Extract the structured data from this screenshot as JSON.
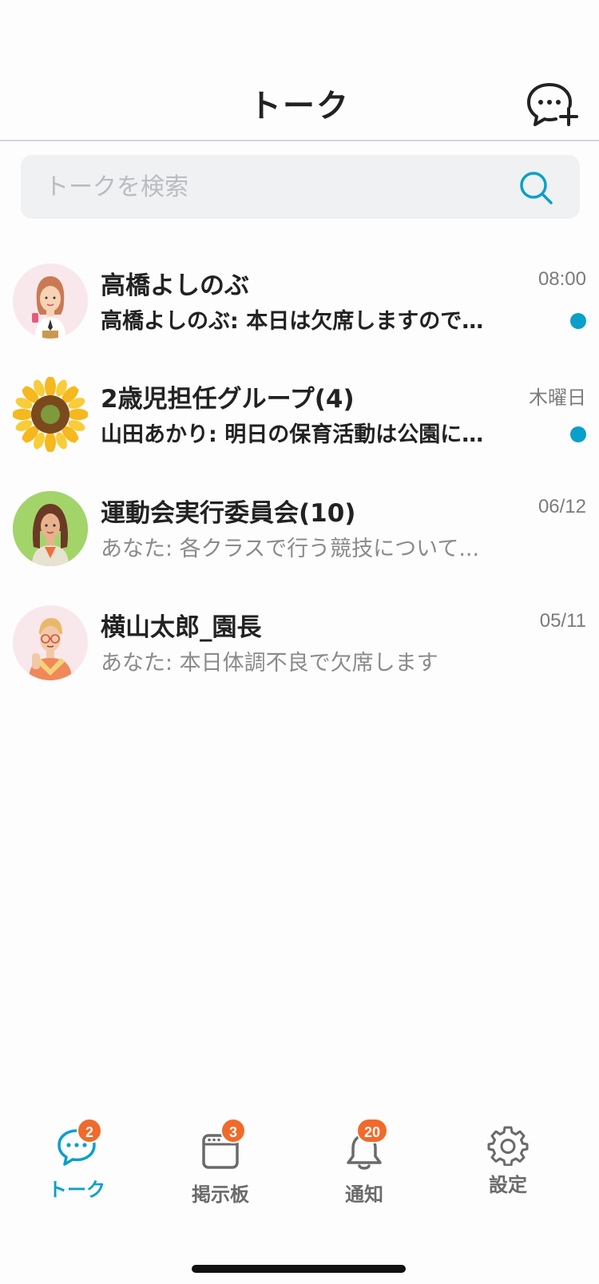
{
  "header": {
    "title": "トーク"
  },
  "search": {
    "placeholder": "トークを検索"
  },
  "accent_color": "#0aa0c9",
  "badge_color": "#f06a2b",
  "conversations": [
    {
      "name": "高橋よしのぶ",
      "time": "08:00",
      "preview": "高橋よしのぶ: 本日は欠席しますので...",
      "unread": true,
      "avatar": "woman-with-phone"
    },
    {
      "name": "2歳児担任グループ(4)",
      "time": "木曜日",
      "preview": "山田あかり: 明日の保育活動は公園に...",
      "unread": true,
      "avatar": "sunflower"
    },
    {
      "name": "運動会実行委員会(10)",
      "time": "06/12",
      "preview": "あなた: 各クラスで行う競技について...",
      "unread": false,
      "avatar": "woman-long-hair"
    },
    {
      "name": "横山太郎_園長",
      "time": "05/11",
      "preview": "あなた: 本日体調不良で欠席します",
      "unread": false,
      "avatar": "man-with-glasses"
    }
  ],
  "tabs": [
    {
      "label": "トーク",
      "badge": "2",
      "icon": "chat-icon",
      "active": true
    },
    {
      "label": "掲示板",
      "badge": "3",
      "icon": "board-icon",
      "active": false
    },
    {
      "label": "通知",
      "badge": "20",
      "icon": "bell-icon",
      "active": false
    },
    {
      "label": "設定",
      "badge": "",
      "icon": "gear-icon",
      "active": false
    }
  ]
}
